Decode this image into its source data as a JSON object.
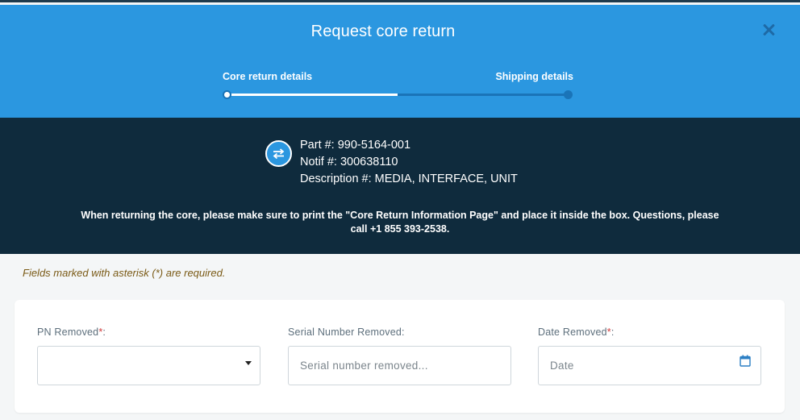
{
  "header": {
    "title": "Request core return",
    "steps": [
      {
        "label": "Core return details"
      },
      {
        "label": "Shipping details"
      }
    ],
    "progress": 0.5
  },
  "info": {
    "part": "Part #: 990-5164-001",
    "notif": "Notif #: 300638110",
    "description": "Description #: MEDIA, INTERFACE, UNIT",
    "notice": "When returning the core, please make sure to print the \"Core Return Information Page\" and place it inside the box. Questions, please call +1 855 393-2538."
  },
  "form": {
    "required_note": "Fields marked with asterisk (*) are required.",
    "pn_removed": {
      "label": "PN Removed",
      "required": "*",
      "suffix": ":",
      "value": ""
    },
    "serial_removed": {
      "label": "Serial Number Removed:",
      "placeholder": "Serial number removed..."
    },
    "date_removed": {
      "label": "Date Removed",
      "required": "*",
      "suffix": ":",
      "placeholder": "Date"
    }
  },
  "icons": {
    "close": "close-icon",
    "swap": "swap-arrows-icon",
    "dropdown": "caret-down-icon",
    "calendar": "calendar-icon"
  },
  "colors": {
    "header_bg": "#2b97e0",
    "info_bg": "#0f2b3d",
    "required_note": "#7a5a16",
    "asterisk": "#d13c3c"
  }
}
